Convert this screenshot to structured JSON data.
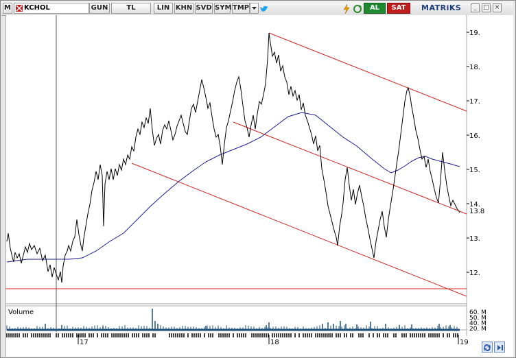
{
  "toolbar": {
    "m_label": "M",
    "symbol": "KCHOL",
    "buttons": [
      "GUN",
      "TL",
      "LIN",
      "KHN",
      "SVD",
      "SYM",
      "TMP"
    ],
    "buy_label": "AL",
    "sell_label": "SAT",
    "brand": "MATRiKS",
    "icons": [
      "dropdown-arrow-icon",
      "twitter-icon",
      "lightning-icon",
      "refresh-icon",
      "minimize-icon",
      "maximize-icon",
      "close-icon"
    ]
  },
  "price_axis": {
    "ticks": [
      "19.",
      "18.",
      "17.",
      "16.",
      "15.",
      "14.",
      "13.",
      "12."
    ],
    "last_price_label": "13.8"
  },
  "volume_panel": {
    "title": "Volume",
    "ticks": [
      "60. M",
      "50. M",
      "40. M",
      "20. M"
    ]
  },
  "time_axis": {
    "labels": [
      "17",
      "18",
      "19"
    ]
  },
  "colors": {
    "price_line": "#000000",
    "moving_average": "#1a1a8c",
    "channel_lines": "#cc2222",
    "volume_bars": "#1f4f7a",
    "buy": "#1f8a2f",
    "sell": "#c21d1d"
  }
}
